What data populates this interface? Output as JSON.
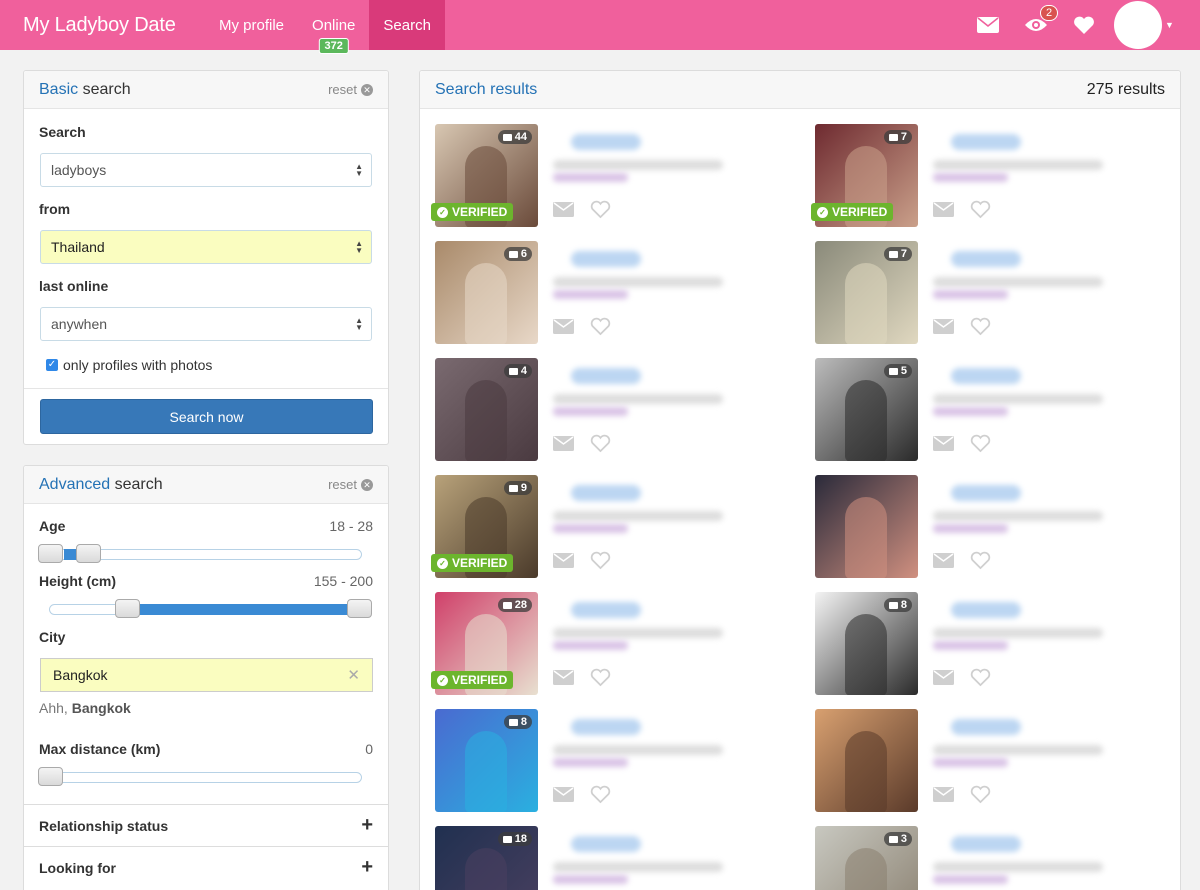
{
  "navbar": {
    "brand": "My Ladyboy Date",
    "links": [
      {
        "label": "My profile"
      },
      {
        "label": "Online",
        "badge": "372"
      },
      {
        "label": "Search",
        "active": true
      }
    ],
    "eye_badge": "2"
  },
  "basic_search": {
    "title_highlight": "Basic",
    "title_rest": " search",
    "reset_label": "reset",
    "search_label": "Search",
    "search_value": "ladyboys",
    "from_label": "from",
    "from_value": "Thailand",
    "last_online_label": "last online",
    "last_online_value": "anywhen",
    "photos_checkbox_label": "only profiles with photos",
    "photos_checked": true,
    "submit_label": "Search now"
  },
  "advanced_search": {
    "title_highlight": "Advanced",
    "title_rest": " search",
    "reset_label": "reset",
    "age_label": "Age",
    "age_value": "18 - 28",
    "height_label": "Height (cm)",
    "height_value": "155 - 200",
    "city_label": "City",
    "city_value": "Bangkok",
    "city_hint_prefix": "Ahh, ",
    "city_hint_bold": "Bangkok",
    "distance_label": "Max distance (km)",
    "distance_value": "0",
    "sections": [
      "Relationship status",
      "Looking for"
    ]
  },
  "results": {
    "title": "Search results",
    "count": "275 results",
    "items": [
      {
        "photos": "44",
        "verified": true
      },
      {
        "photos": "7",
        "verified": true
      },
      {
        "photos": "6",
        "verified": false
      },
      {
        "photos": "7",
        "verified": false
      },
      {
        "photos": "4",
        "verified": false
      },
      {
        "photos": "5",
        "verified": false
      },
      {
        "photos": "9",
        "verified": true
      },
      {
        "photos": "",
        "verified": false
      },
      {
        "photos": "28",
        "verified": true
      },
      {
        "photos": "8",
        "verified": false
      },
      {
        "photos": "8",
        "verified": false
      },
      {
        "photos": "",
        "verified": false
      },
      {
        "photos": "18",
        "verified": false
      },
      {
        "photos": "3",
        "verified": false
      }
    ],
    "verified_label": "VERIFIED"
  },
  "colors": {
    "navbar": "#f0609c",
    "navbar_active": "#d93a7a",
    "link_blue": "#2472b5",
    "primary_button": "#3778b8",
    "verified": "#6cb52d",
    "online_badge": "#5cb85c"
  }
}
